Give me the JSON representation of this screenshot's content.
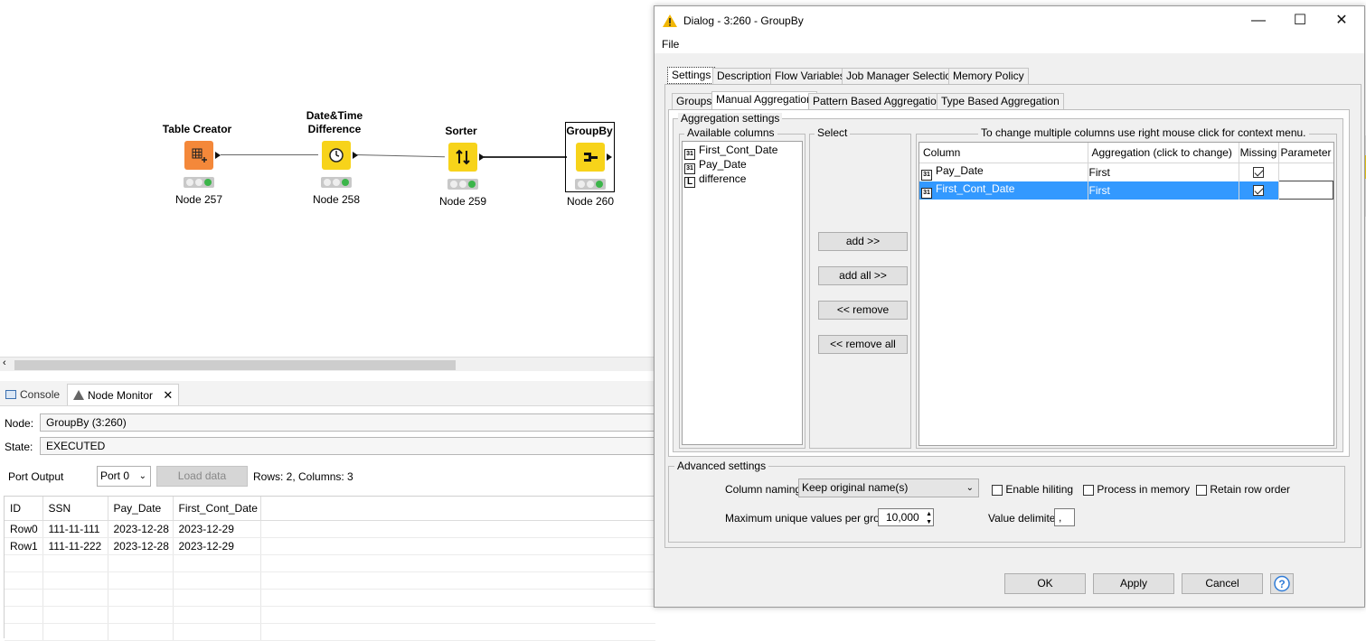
{
  "workflow": {
    "nodes": [
      {
        "title": "Table Creator",
        "label": "Node 257",
        "color": "#f4883a"
      },
      {
        "title_line1": "Date&Time",
        "title_line2": "Difference",
        "label": "Node 258",
        "color": "#f7d31a"
      },
      {
        "title": "Sorter",
        "label": "Node 259",
        "color": "#f7d31a"
      },
      {
        "title": "GroupBy",
        "label": "Node 260",
        "color": "#f7d31a"
      }
    ]
  },
  "bottom_panel": {
    "tabs": [
      {
        "label": "Console",
        "icon": "console-icon"
      },
      {
        "label": "Node Monitor",
        "icon": "node-monitor-icon"
      }
    ],
    "node_label": "Node:",
    "node_value": "GroupBy  (3:260)",
    "state_label": "State:",
    "state_value": "EXECUTED",
    "port_output_label": "Port Output",
    "port_select": "Port 0",
    "load_data_label": "Load data",
    "rows_info": "Rows: 2, Columns: 3",
    "table": {
      "headers": [
        "ID",
        "SSN",
        "Pay_Date",
        "First_Cont_Date"
      ],
      "rows": [
        [
          "Row0",
          "111-11-111",
          "2023-12-28",
          "2023-12-29"
        ],
        [
          "Row1",
          "111-11-222",
          "2023-12-28",
          "2023-12-29"
        ]
      ]
    }
  },
  "dialog": {
    "title": "Dialog - 3:260 - GroupBy",
    "menu_file": "File",
    "main_tabs": [
      "Settings",
      "Description",
      "Flow Variables",
      "Job Manager Selection",
      "Memory Policy"
    ],
    "sub_tabs": [
      "Groups",
      "Manual Aggregation",
      "Pattern Based Aggregation",
      "Type Based Aggregation"
    ],
    "aggregation_settings_title": "Aggregation settings",
    "available_columns_title": "Available columns",
    "available_columns": [
      {
        "name": "First_Cont_Date",
        "icon": "31"
      },
      {
        "name": "Pay_Date",
        "icon": "31"
      },
      {
        "name": "difference",
        "icon": "L"
      }
    ],
    "select_title": "Select",
    "buttons": {
      "add": "add >>",
      "add_all": "add all >>",
      "remove": "<< remove",
      "remove_all": "<< remove all"
    },
    "hint": "To change multiple columns use right mouse click for context menu.",
    "agg_table": {
      "headers": [
        "Column",
        "Aggregation (click to change)",
        "Missing",
        "Parameter"
      ],
      "rows": [
        {
          "icon": "31",
          "column": "Pay_Date",
          "aggregation": "First",
          "missing": true,
          "selected": false
        },
        {
          "icon": "31",
          "column": "First_Cont_Date",
          "aggregation": "First",
          "missing": true,
          "selected": true
        }
      ]
    },
    "advanced_settings_title": "Advanced settings",
    "column_naming_label": "Column naming:",
    "column_naming_value": "Keep original name(s)",
    "enable_hiliting": "Enable hiliting",
    "process_in_memory": "Process in memory",
    "retain_row_order": "Retain row order",
    "max_unique_label": "Maximum unique values per group",
    "max_unique_value": "10,000",
    "value_delimiter_label": "Value delimiter",
    "value_delimiter_value": ",",
    "ok_label": "OK",
    "apply_label": "Apply",
    "cancel_label": "Cancel",
    "selected_row_color": "#3399ff"
  }
}
